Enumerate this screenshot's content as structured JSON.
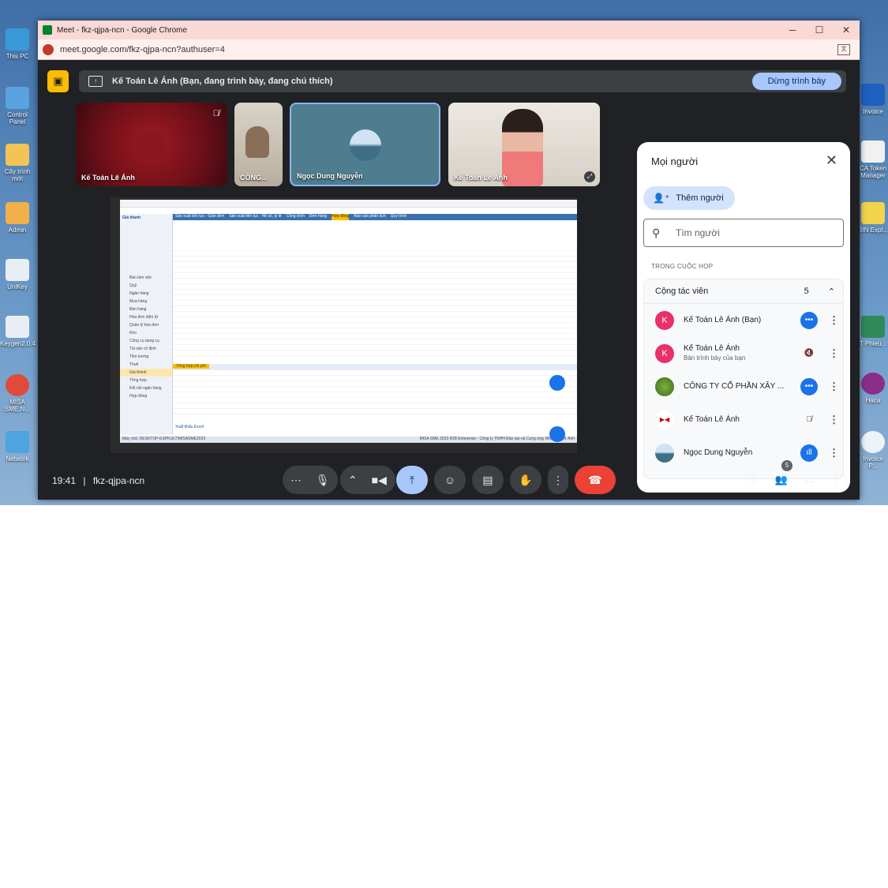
{
  "desktop_icons": [
    "This PC",
    "Control Panel",
    "Cây trình mới",
    "Admin",
    "UniKey",
    "Keygen2.0.4",
    "MISA SME.N...",
    "Network",
    "Invoice",
    "CA Token Manager",
    "BIN Expl...",
    "T Phieu...",
    "Haca",
    "Invoice P..."
  ],
  "browser": {
    "title": "Meet - fkz-qjpa-ncn - Google Chrome",
    "url": "meet.google.com/fkz-qjpa-ncn?authuser=4",
    "controls": {
      "minimize": "─",
      "maximize": "☐",
      "close": "✕"
    }
  },
  "presenting": {
    "text": "Kế Toán Lê Ánh (Bạn, đang trình bày, đang chú thích)",
    "stop_label": "Dừng trình bày"
  },
  "tiles": [
    {
      "name": "Kế Toán Lê Ánh",
      "muted": true
    },
    {
      "name": "CÔNG..."
    },
    {
      "name": "Ngọc Dung Nguyễn"
    },
    {
      "name": "Kế Toán Lê Ánh"
    }
  ],
  "shared_screen": {
    "app_title": "MISA SME 2023",
    "tabs": [
      "Sản xuất liên tục - Giản đơn",
      "Sản xuất liên tục - Hệ số, tỷ lệ",
      "Công trình",
      "Đơn hàng",
      "Hợp đồng",
      "Báo cáo phân tích",
      "Quy trình"
    ],
    "left_menu": [
      "Bàn làm việc",
      "Quỹ",
      "Ngân hàng",
      "Mua hàng",
      "Bán hàng",
      "Hóa đơn điện tử",
      "Quản lý hóa đơn",
      "Kho",
      "Công cụ dụng cụ",
      "Tài sản cố định",
      "Tiền lương",
      "Thuế",
      "Giá thành",
      "Tổng hợp",
      "Kết nối ngân hàng",
      "Hợp đồng"
    ],
    "left_menu_title": "Giá thành",
    "bottom_tab": "Tổng hợp chi phí",
    "export_label": "Xuất khẩu Excel",
    "status_left": "Máy chủ: DESKTOP-ESPKULT\\MISASME2023",
    "status_right": "MISA SME 2023 R28 Enterprise - Công ty TNHH Đào tạo và Cung ứng Nhân lực Lê Ánh"
  },
  "people_panel": {
    "title": "Mọi người",
    "add_label": "Thêm người",
    "search_placeholder": "Tìm người",
    "section_label": "TRONG CUỘC HỌP",
    "group_name": "Cộng tác viên",
    "group_count": "5",
    "people": [
      {
        "name": "Kế Toán Lê Ánh (Bạn)",
        "sub": "",
        "avatar": "K",
        "avatar_color": "#e8306a",
        "icon": "more"
      },
      {
        "name": "Kế Toán Lê Ánh",
        "sub": "Bản trình bày của bạn",
        "avatar": "K",
        "avatar_color": "#e8306a",
        "icon": "mute"
      },
      {
        "name": "CÔNG TY CỔ PHẦN XÂY ...",
        "sub": "",
        "avatar": "",
        "avatar_color": "#4c7a2a",
        "icon": "more"
      },
      {
        "name": "Kế Toán Lê Ánh",
        "sub": "",
        "avatar": "",
        "avatar_color": "#ffffff",
        "icon": "mic-off"
      },
      {
        "name": "Ngọc Dung Nguyễn",
        "sub": "",
        "avatar": "",
        "avatar_color": "#6a8fb8",
        "icon": "speaking"
      }
    ]
  },
  "bottom": {
    "time": "19:41",
    "meeting_code": "fkz-qjpa-ncn",
    "participants_badge": "5"
  }
}
